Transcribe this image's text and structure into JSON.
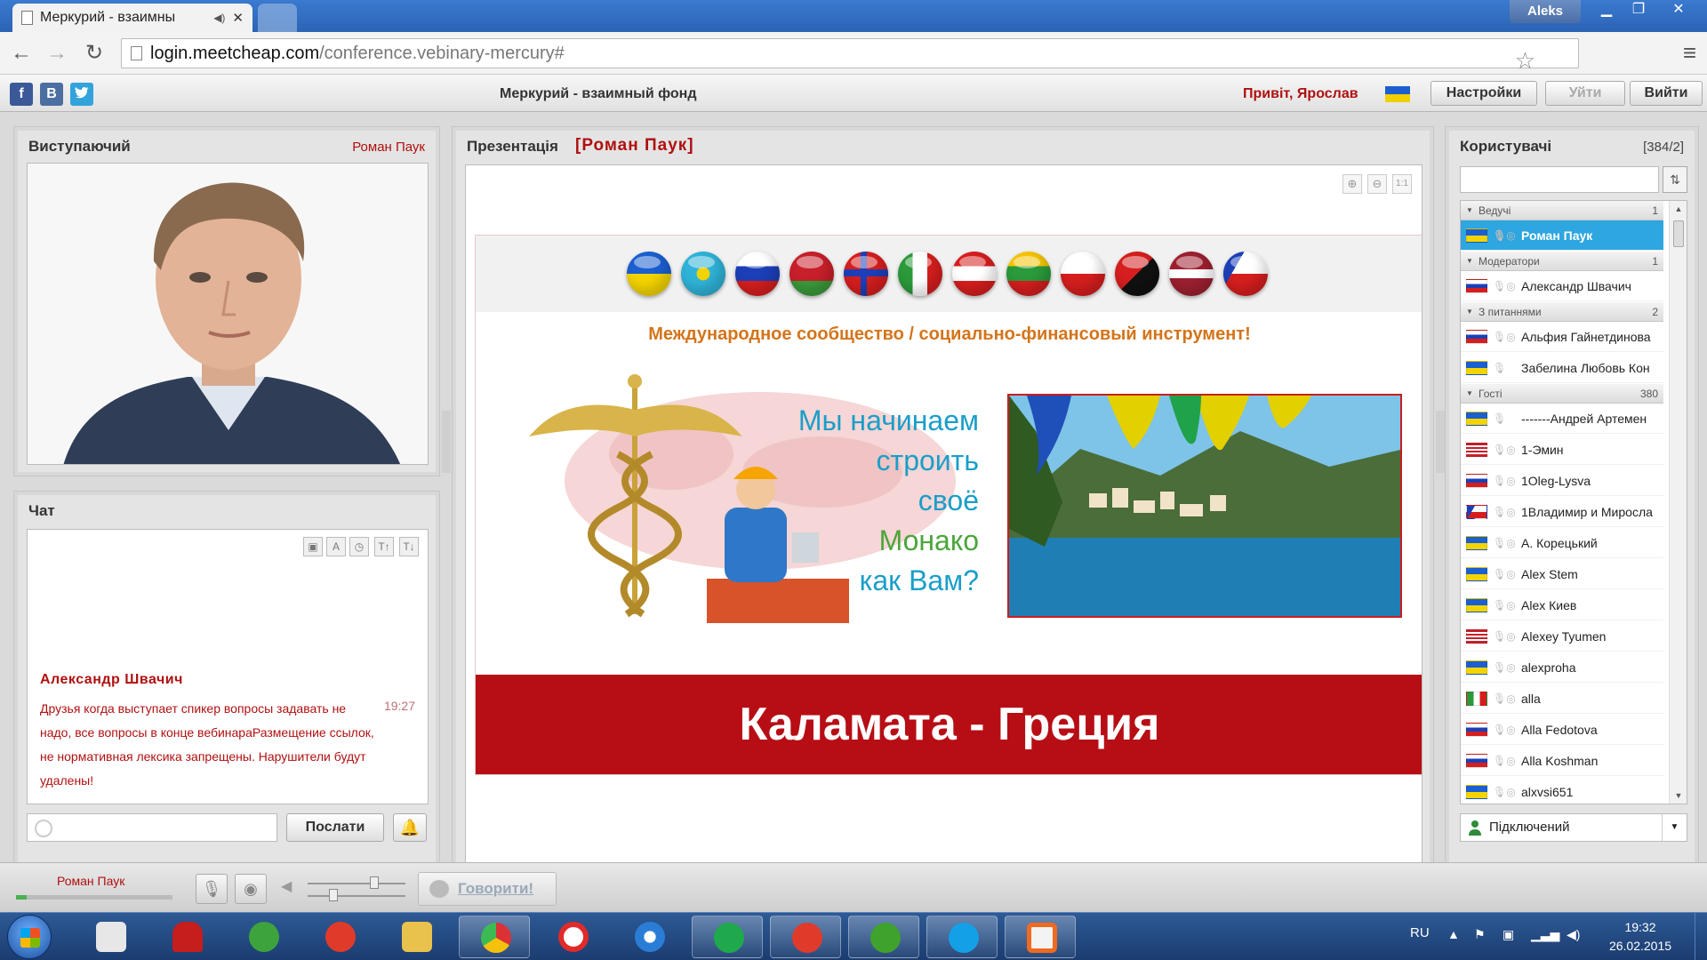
{
  "browser": {
    "tab_title": "Меркурий - взаимны",
    "url_host": "login.meetcheap.com",
    "url_path": "/conference.vebinary-mercury#",
    "user_badge": "Aleks"
  },
  "header": {
    "social": [
      "f",
      "B"
    ],
    "conference_title": "Меркурий - взаимный фонд",
    "greeting": "Привіт, Ярослав",
    "settings_label": "Настройки",
    "leave_label": "Уйти",
    "exit_label": "Вийти"
  },
  "speaker": {
    "title": "Виступаючий",
    "name": "Роман Паук"
  },
  "chat": {
    "title": "Чат",
    "message": {
      "author": "Александр Швачич",
      "time": "19:27",
      "text": "Друзья когда выступает спикер вопросы задавать не надо, все вопросы в конце вебинараРазмещение ссылок, не нормативная лексика запрещены. Нарушители будут удалены!"
    },
    "send_label": "Послати"
  },
  "presentation": {
    "title": "Презентація",
    "owner": "[Роман Паук]",
    "zoom_reset": "1:1",
    "slide": {
      "subtitle": "Международное сообщество / социально-финансовый инструмент!",
      "slogan": [
        "Мы начинаем",
        "строить",
        "своё",
        "Монако",
        "как Вам?"
      ],
      "banner": "Каламата - Греция"
    }
  },
  "users": {
    "title": "Користувачі",
    "count": "[384/2]",
    "groups": [
      {
        "label": "Ведучі",
        "count": "1"
      },
      {
        "label": "Модератори",
        "count": "1"
      },
      {
        "label": "З питаннями",
        "count": "2"
      },
      {
        "label": "Гості",
        "count": "380"
      }
    ],
    "list": [
      {
        "name": "Роман Паук",
        "flag": "ua",
        "selected": true
      },
      {
        "name": "Александр Швачич",
        "flag": "ru"
      },
      {
        "name": "Альфия Гайнетдинова",
        "flag": "ru"
      },
      {
        "name": "Забелина Любовь Кон",
        "flag": "ua"
      },
      {
        "name": "-------Андрей Артемен",
        "flag": "ua"
      },
      {
        "name": "1-Эмин",
        "flag": "us"
      },
      {
        "name": "1Oleg-Lysva",
        "flag": "ru"
      },
      {
        "name": "1Владимир и Миросла",
        "flag": "cz"
      },
      {
        "name": "А. Корецький",
        "flag": "ua"
      },
      {
        "name": "Alex Stem",
        "flag": "ua"
      },
      {
        "name": "Alex Киев",
        "flag": "ua"
      },
      {
        "name": "Alexey Tyumen",
        "flag": "us"
      },
      {
        "name": "alexproha",
        "flag": "ua"
      },
      {
        "name": "alla",
        "flag": "it"
      },
      {
        "name": "Alla Fedotova",
        "flag": "ru"
      },
      {
        "name": "Alla Koshman",
        "flag": "ru"
      },
      {
        "name": "alxvsi651",
        "flag": "ua"
      }
    ],
    "status": "Підключений"
  },
  "bottom": {
    "self_name": "Роман Паук",
    "talk_label": "Говорити!",
    "mic_level": 0.07
  },
  "taskbar": {
    "lang": "RU",
    "time": "19:32",
    "date": "26.02.2015"
  },
  "colors": {
    "accent_red": "#b01010",
    "selection_blue": "#2ea6e0",
    "banner_red": "#b70e15"
  }
}
